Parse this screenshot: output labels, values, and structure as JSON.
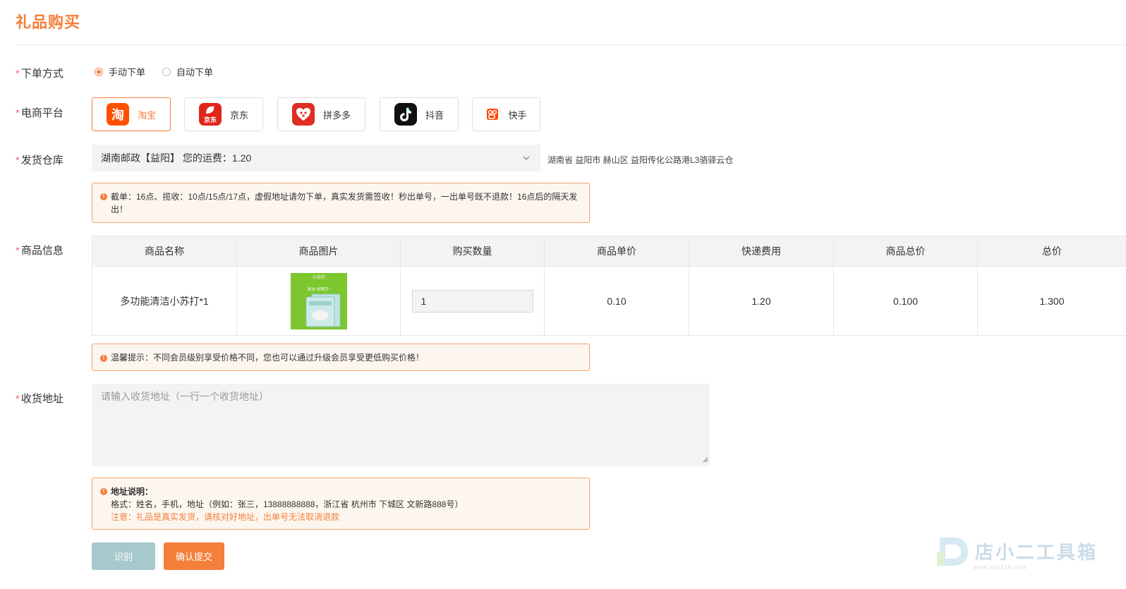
{
  "page": {
    "title": "礼品购买"
  },
  "order_mode": {
    "label": "下单方式",
    "options": [
      {
        "label": "手动下单",
        "checked": true
      },
      {
        "label": "自动下单",
        "checked": false
      }
    ]
  },
  "platform": {
    "label": "电商平台",
    "options": [
      {
        "label": "淘宝",
        "icon": "taobao-icon",
        "icon_text": "淘",
        "active": true
      },
      {
        "label": "京东",
        "icon": "jd-icon",
        "icon_text": "京东",
        "active": false
      },
      {
        "label": "拼多多",
        "icon": "pinduoduo-icon",
        "active": false
      },
      {
        "label": "抖音",
        "icon": "douyin-icon",
        "active": false
      },
      {
        "label": "快手",
        "icon": "kuaishou-icon",
        "active": false
      }
    ]
  },
  "warehouse": {
    "label": "发货仓库",
    "selected": "湖南邮政【益阳】 您的运费：1.20",
    "address": "湖南省 益阳市 赫山区 益阳传化公路港L3骆驿云仓",
    "notice_line1": "截单：16点、揽收：10点/15点/17点，虚假地址请勿下单，真实发货需签收！秒出单号，一出单号既不退款！16点后的隔天发",
    "notice_line2": "出！"
  },
  "product": {
    "label": "商品信息",
    "columns": [
      "商品名称",
      "商品图片",
      "购买数量",
      "商品单价",
      "快递费用",
      "商品总价",
      "总价"
    ],
    "row": {
      "name": "多功能清洁小苏打*1",
      "image_title": "小苏打",
      "image_caption": "清洁“好帮手”",
      "quantity": "1",
      "unit_price": "0.10",
      "shipping": "1.20",
      "goods_total": "0.100",
      "total": "1.300"
    },
    "tip": "温馨提示：不同会员级别享受价格不同，您也可以通过升级会员享受更低购买价格！"
  },
  "address": {
    "label": "收货地址",
    "placeholder": "请输入收货地址（一行一个收货地址）",
    "notice_title": "地址说明：",
    "notice_format": "格式：姓名，手机，地址（例如：张三，13888888888，浙江省 杭州市 下城区 文新路888号）",
    "notice_warning": "注意：礼品是真实发货，请核对好地址，出单号无法取消退款"
  },
  "buttons": {
    "recognize": "识别",
    "submit": "确认提交"
  },
  "watermark": {
    "text": "店小二工具箱",
    "url": "www.sd1118.com"
  },
  "colors": {
    "accent": "#f47f3a",
    "required": "#f56c6c",
    "recognize_button": "#a5c9cc"
  }
}
